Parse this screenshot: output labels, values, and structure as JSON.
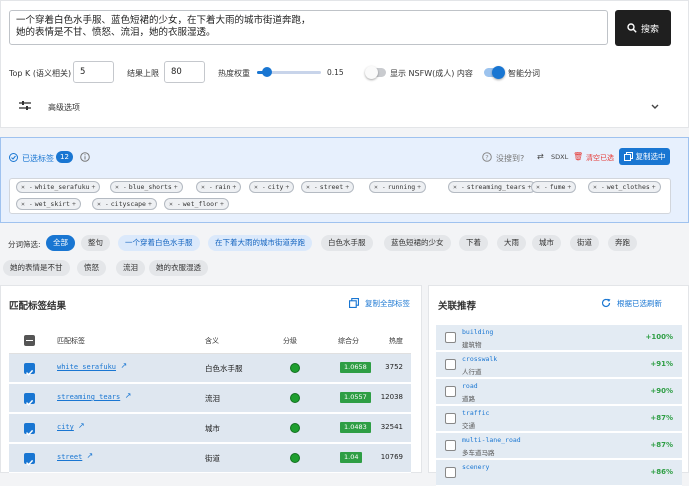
{
  "search": {
    "text_line1": "一个穿着白色水手服、蓝色短裙的少女，在下着大雨的城市街道奔跑，",
    "text_line2": "她的表情是不甘、愤怒、流泪，她的衣服湿透。",
    "button": "搜索"
  },
  "params": {
    "topk_label": "Top K (语义相关)",
    "topk_value": "5",
    "limit_label": "结果上限",
    "limit_value": "80",
    "heat_label": "热度权重",
    "heat_value": "0.15",
    "heat_fraction": 0.15,
    "nsfw_label": "显示 NSFW(成人) 内容",
    "nsfw_on": false,
    "smart_label": "智能分词",
    "smart_on": true,
    "advanced_label": "高级选项"
  },
  "selected": {
    "title": "已选标签",
    "count": "12",
    "notfound": "没搜到?",
    "sdxl": "SDXL",
    "clear": "清空已选",
    "copy": "复制选中",
    "tags": [
      "white_serafuku",
      "blue_shorts",
      "rain",
      "city",
      "street",
      "running",
      "streaming_tears",
      "fume",
      "wet_clothes",
      "wet_skirt",
      "cityscape",
      "wet_floor"
    ]
  },
  "segments": {
    "label": "分词筛选:",
    "items": [
      "全部",
      "整句",
      "一个穿着白色水手服",
      "在下着大雨的城市街道奔跑",
      "白色水手服",
      "蓝色短裙的少女",
      "下着",
      "大雨",
      "城市",
      "街道",
      "奔跑",
      "她的表情是不甘",
      "愤怒",
      "流泪",
      "她的衣服湿透"
    ]
  },
  "results": {
    "title": "匹配标签结果",
    "copy_all": "复制全部标签",
    "headers": [
      "匹配标签",
      "含义",
      "分级",
      "综合分",
      "热度"
    ],
    "rows": [
      {
        "tag": "white_serafuku",
        "meaning": "白色水手服",
        "score": "1.0658",
        "heat": "3752"
      },
      {
        "tag": "streaming_tears",
        "meaning": "流泪",
        "score": "1.0557",
        "heat": "12038"
      },
      {
        "tag": "city",
        "meaning": "城市",
        "score": "1.0483",
        "heat": "32541"
      },
      {
        "tag": "street",
        "meaning": "街道",
        "score": "1.04",
        "heat": "10769"
      }
    ]
  },
  "recommend": {
    "title": "关联推荐",
    "refresh": "根据已选刷新",
    "items": [
      {
        "tag": "building",
        "zh": "建筑物",
        "pct": "+100%"
      },
      {
        "tag": "crosswalk",
        "zh": "人行道",
        "pct": "+91%"
      },
      {
        "tag": "road",
        "zh": "道路",
        "pct": "+90%"
      },
      {
        "tag": "traffic",
        "zh": "交通",
        "pct": "+87%"
      },
      {
        "tag": "multi-lane_road",
        "zh": "多车道马路",
        "pct": "+87%"
      },
      {
        "tag": "scenery",
        "zh": "",
        "pct": "+86%"
      }
    ]
  },
  "colors": {
    "accent": "#1976d2",
    "green_badge": "#2e9e44",
    "red": "#e53935"
  }
}
